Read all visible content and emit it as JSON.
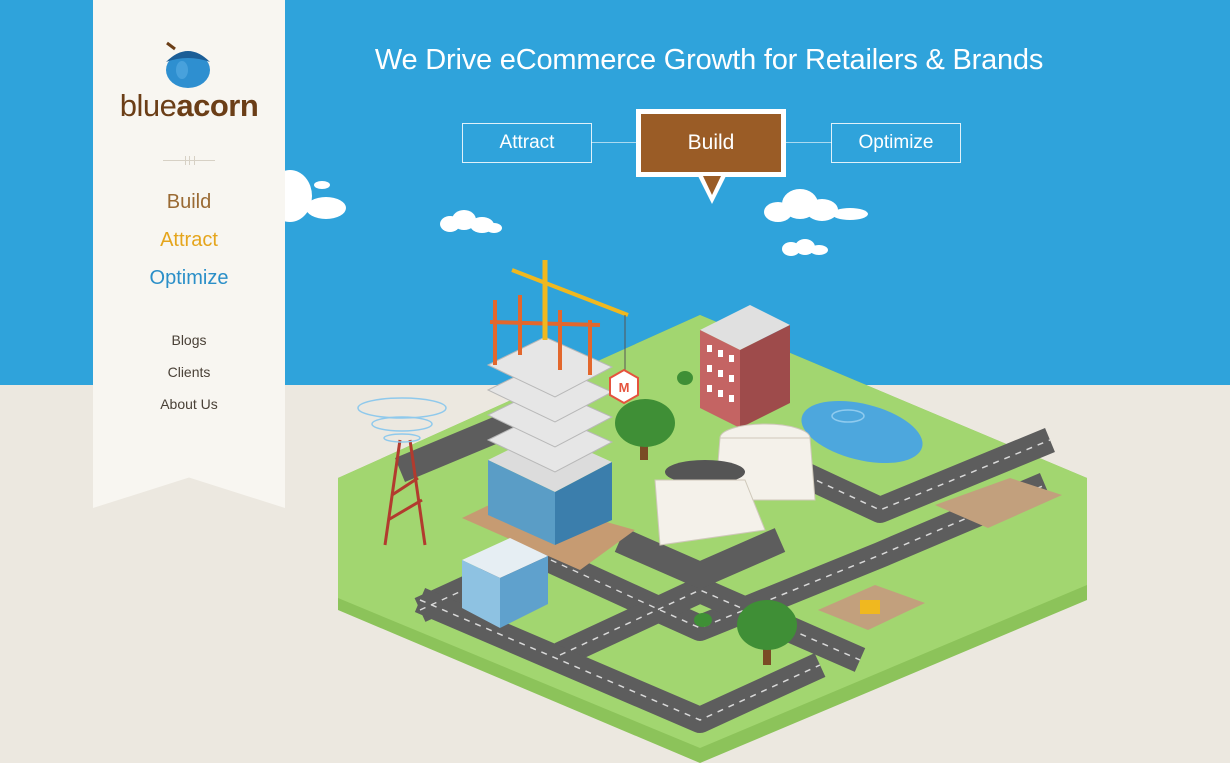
{
  "brand": {
    "name_part1": "blue",
    "name_part2": "acorn"
  },
  "sidebar": {
    "primary_nav": [
      {
        "label": "Build",
        "color": "#9a6a33"
      },
      {
        "label": "Attract",
        "color": "#e5a51c"
      },
      {
        "label": "Optimize",
        "color": "#2b8fc8"
      }
    ],
    "secondary_nav": [
      "Blogs",
      "Clients",
      "About Us"
    ]
  },
  "hero": {
    "headline": "We Drive eCommerce Growth for Retailers & Brands",
    "tabs": {
      "attract": "Attract",
      "build": "Build",
      "optimize": "Optimize"
    },
    "active_tab": "Build"
  },
  "colors": {
    "sky": "#2fa3db",
    "ground": "#ece8e0",
    "accent_brown": "#9a5c26",
    "grass": "#9fd26c",
    "road": "#6b6b6b"
  },
  "icons": [
    "acorn-logo-icon",
    "magento-icon",
    "cloud-icon",
    "tree-icon",
    "crane-icon"
  ]
}
